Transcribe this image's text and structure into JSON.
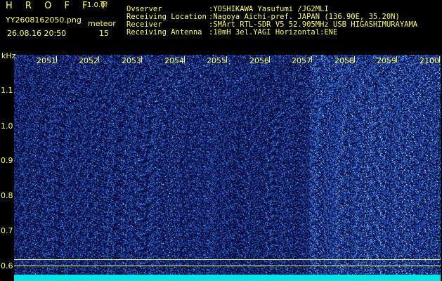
{
  "header": {
    "brand": "H R O F F T",
    "version": "1.0.0f",
    "filename": "YY2608162050.png",
    "datetime": "26.08.16 20:50",
    "event_label": "meteor",
    "event_count": "15",
    "meta": [
      {
        "label": "Ovserver",
        "value": ":YOSHIKAWA Yasufumi /JG2MLI"
      },
      {
        "label": "Receiving Location",
        "value": ":Nagoya Aichi-pref. JAPAN (136.90E, 35.20N)"
      },
      {
        "label": "Receiver",
        "value": ":SMArt RTL-SDR V5 52.905MHz USB HIGASHIMURAYAMA"
      },
      {
        "label": "Receiving Antenna",
        "value": ":10mH 3el.YAGI Horizontal:ENE"
      }
    ]
  },
  "plot": {
    "y_unit": "kHz",
    "x_ticks": [
      "2051",
      "2052",
      "2053",
      "2054",
      "2055",
      "2056",
      "2057",
      "2058",
      "2059",
      "2100"
    ],
    "y_ticks": [
      "1.1",
      "1.0",
      "0.9",
      "0.8",
      "0.7",
      "0.6"
    ],
    "colors": {
      "background": "#0b1240",
      "noise": "#3b5cff",
      "bright": "#d8ffff",
      "baseline": "#00e6e6",
      "label": "#ffff66"
    }
  }
}
